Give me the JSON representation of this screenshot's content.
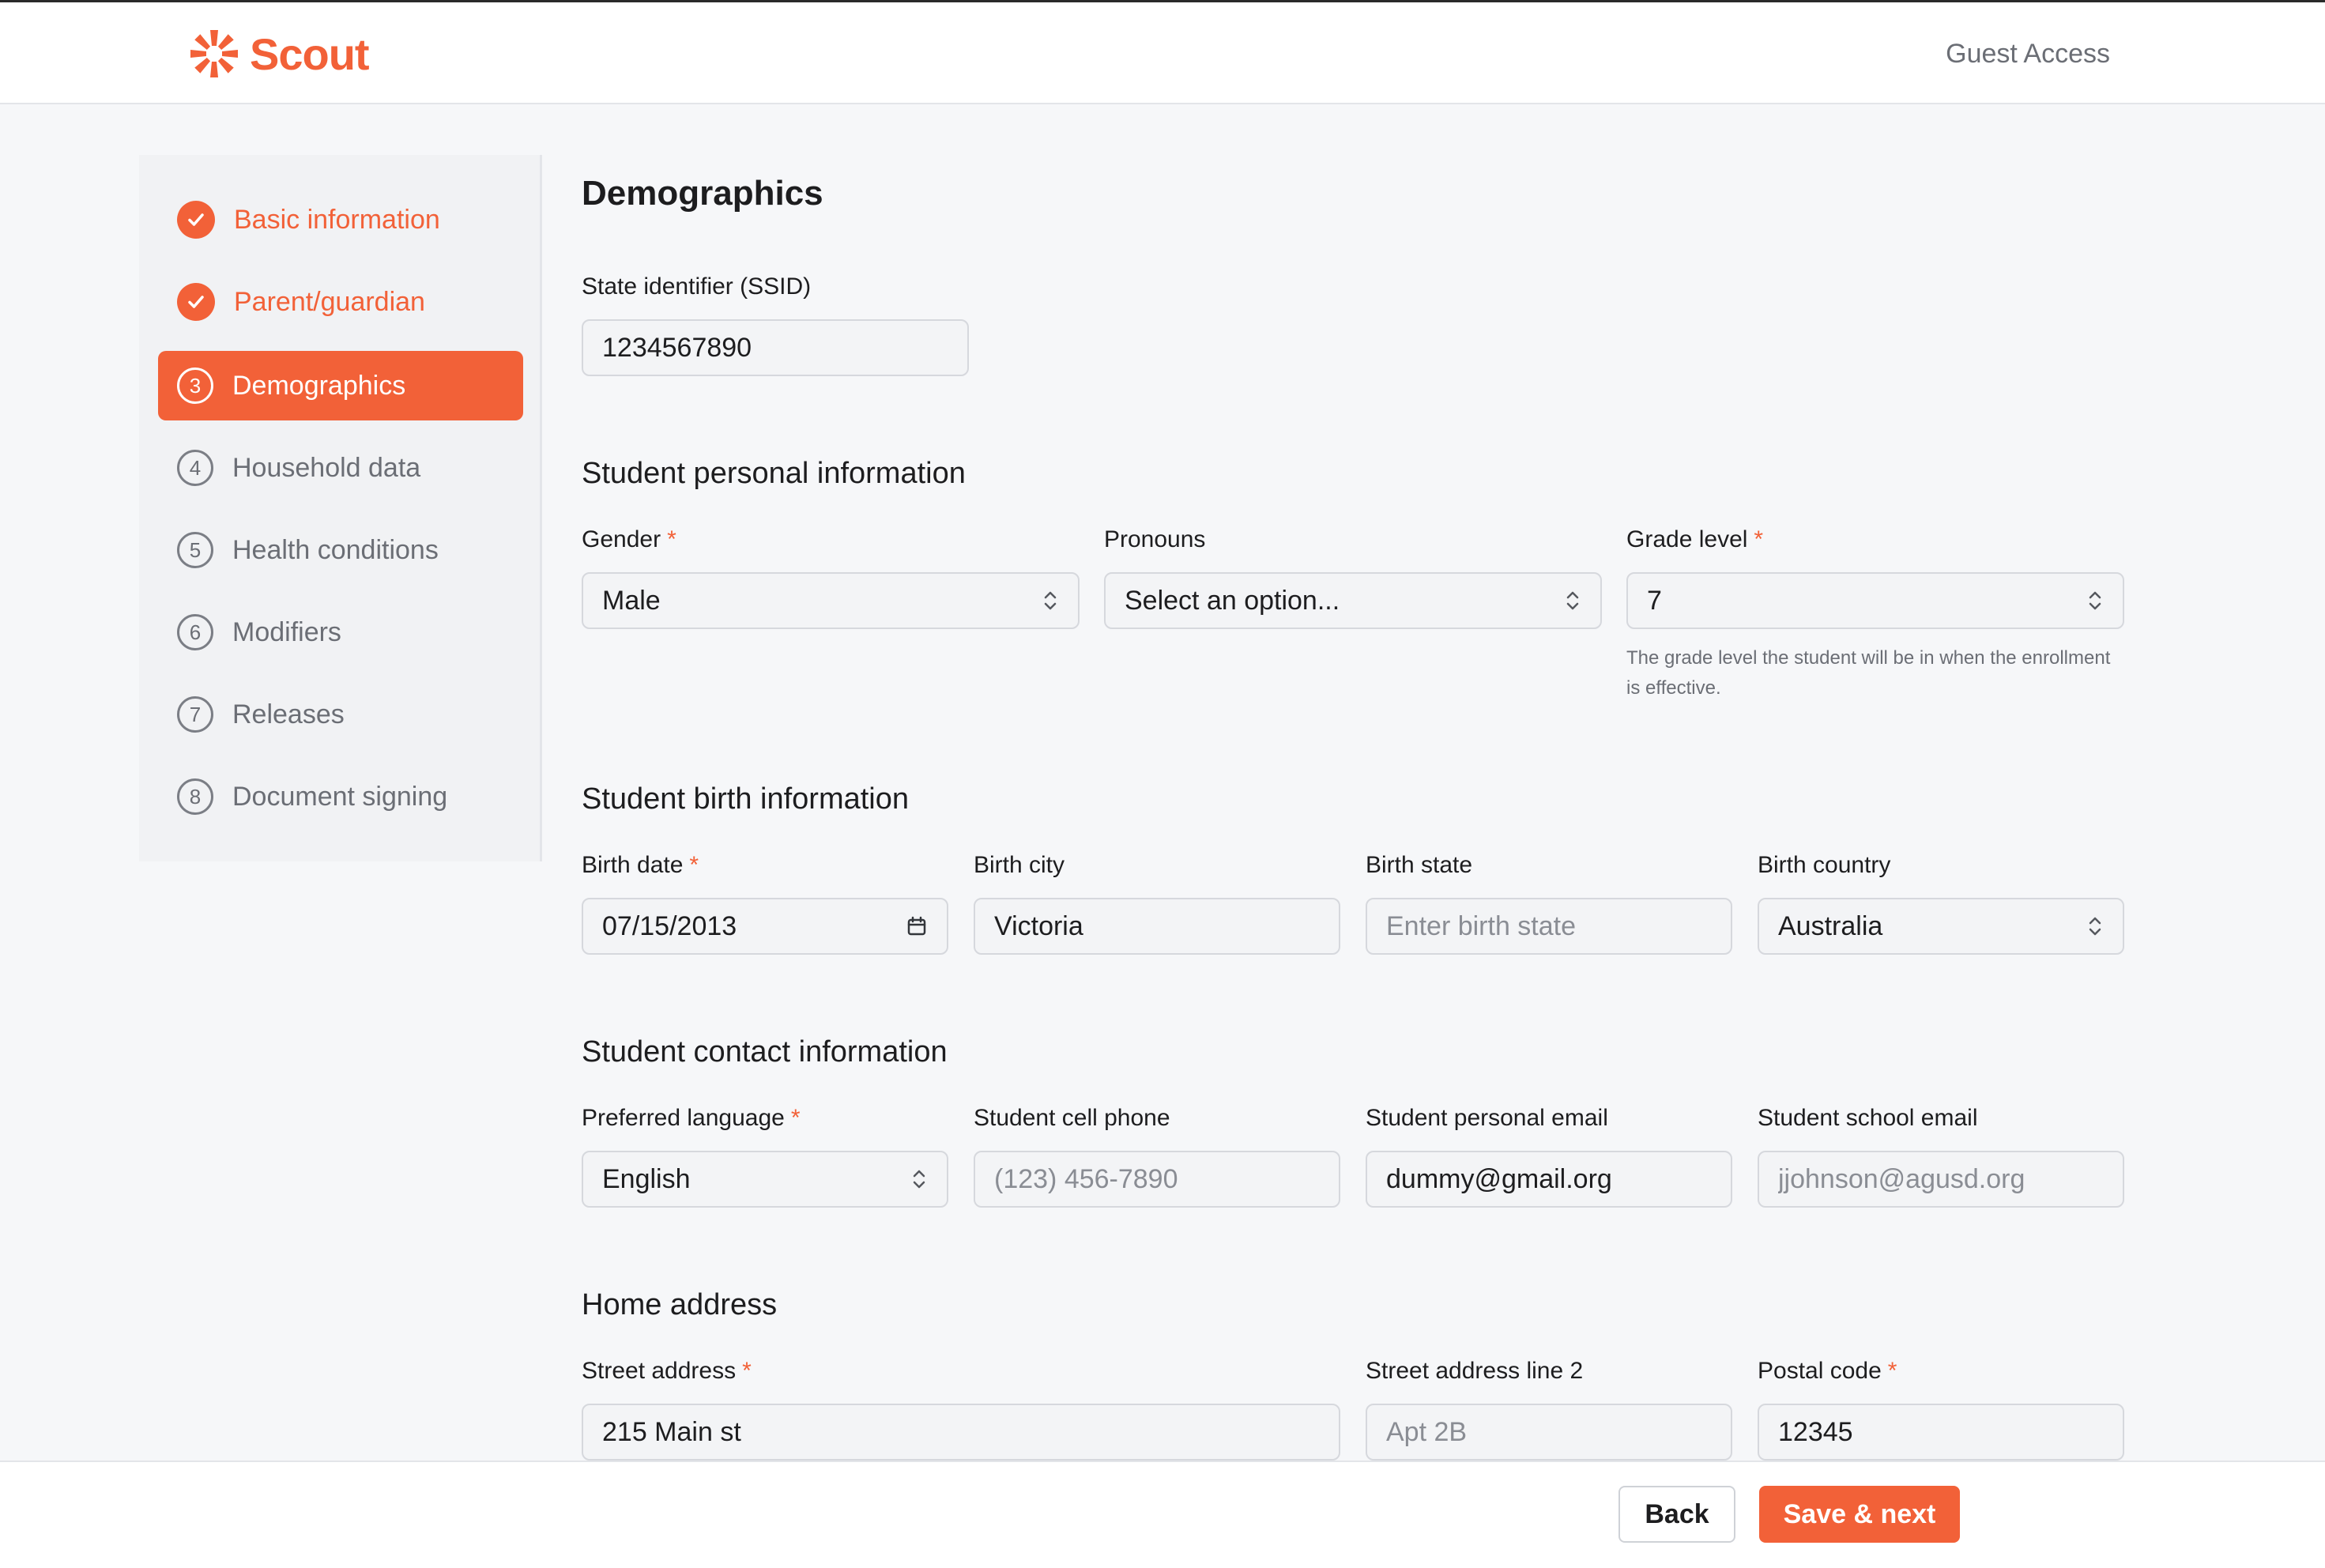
{
  "header": {
    "brand": "Scout",
    "account_label": "Guest Access"
  },
  "colors": {
    "accent": "#f26138",
    "background": "#f6f7f9",
    "muted_text": "#6b6e75"
  },
  "sidebar": {
    "steps": [
      {
        "number": "1",
        "label": "Basic information",
        "state": "complete"
      },
      {
        "number": "2",
        "label": "Parent/guardian",
        "state": "complete"
      },
      {
        "number": "3",
        "label": "Demographics",
        "state": "active"
      },
      {
        "number": "4",
        "label": "Household data",
        "state": "pending"
      },
      {
        "number": "5",
        "label": "Health conditions",
        "state": "pending"
      },
      {
        "number": "6",
        "label": "Modifiers",
        "state": "pending"
      },
      {
        "number": "7",
        "label": "Releases",
        "state": "pending"
      },
      {
        "number": "8",
        "label": "Document signing",
        "state": "pending"
      }
    ]
  },
  "main": {
    "title": "Demographics",
    "ssid": {
      "label": "State identifier (SSID)",
      "value": "1234567890"
    },
    "personal": {
      "title": "Student personal information",
      "gender": {
        "label": "Gender",
        "required_mark": "*",
        "value": "Male"
      },
      "pronouns": {
        "label": "Pronouns",
        "value": "Select an option..."
      },
      "grade": {
        "label": "Grade level",
        "required_mark": "*",
        "value": "7",
        "hint": "The grade level the student will be in when the enrollment is effective."
      }
    },
    "birth": {
      "title": "Student birth information",
      "date": {
        "label": "Birth date",
        "required_mark": "*",
        "value": "07/15/2013"
      },
      "city": {
        "label": "Birth city",
        "value": "Victoria"
      },
      "state": {
        "label": "Birth state",
        "placeholder": "Enter birth state"
      },
      "country": {
        "label": "Birth country",
        "value": "Australia"
      }
    },
    "contact": {
      "title": "Student contact information",
      "language": {
        "label": "Preferred language",
        "required_mark": "*",
        "value": "English"
      },
      "cell_phone": {
        "label": "Student cell phone",
        "placeholder": "(123) 456-7890"
      },
      "personal_email": {
        "label": "Student personal email",
        "value": "dummy@gmail.org"
      },
      "school_email": {
        "label": "Student school email",
        "placeholder": "jjohnson@agusd.org"
      }
    },
    "address": {
      "title": "Home address",
      "street": {
        "label": "Street address",
        "required_mark": "*",
        "value": "215 Main st"
      },
      "street2": {
        "label": "Street address line 2",
        "placeholder": "Apt 2B"
      },
      "postal": {
        "label": "Postal code",
        "required_mark": "*",
        "value": "12345"
      }
    }
  },
  "footer": {
    "back_label": "Back",
    "save_label": "Save & next"
  }
}
